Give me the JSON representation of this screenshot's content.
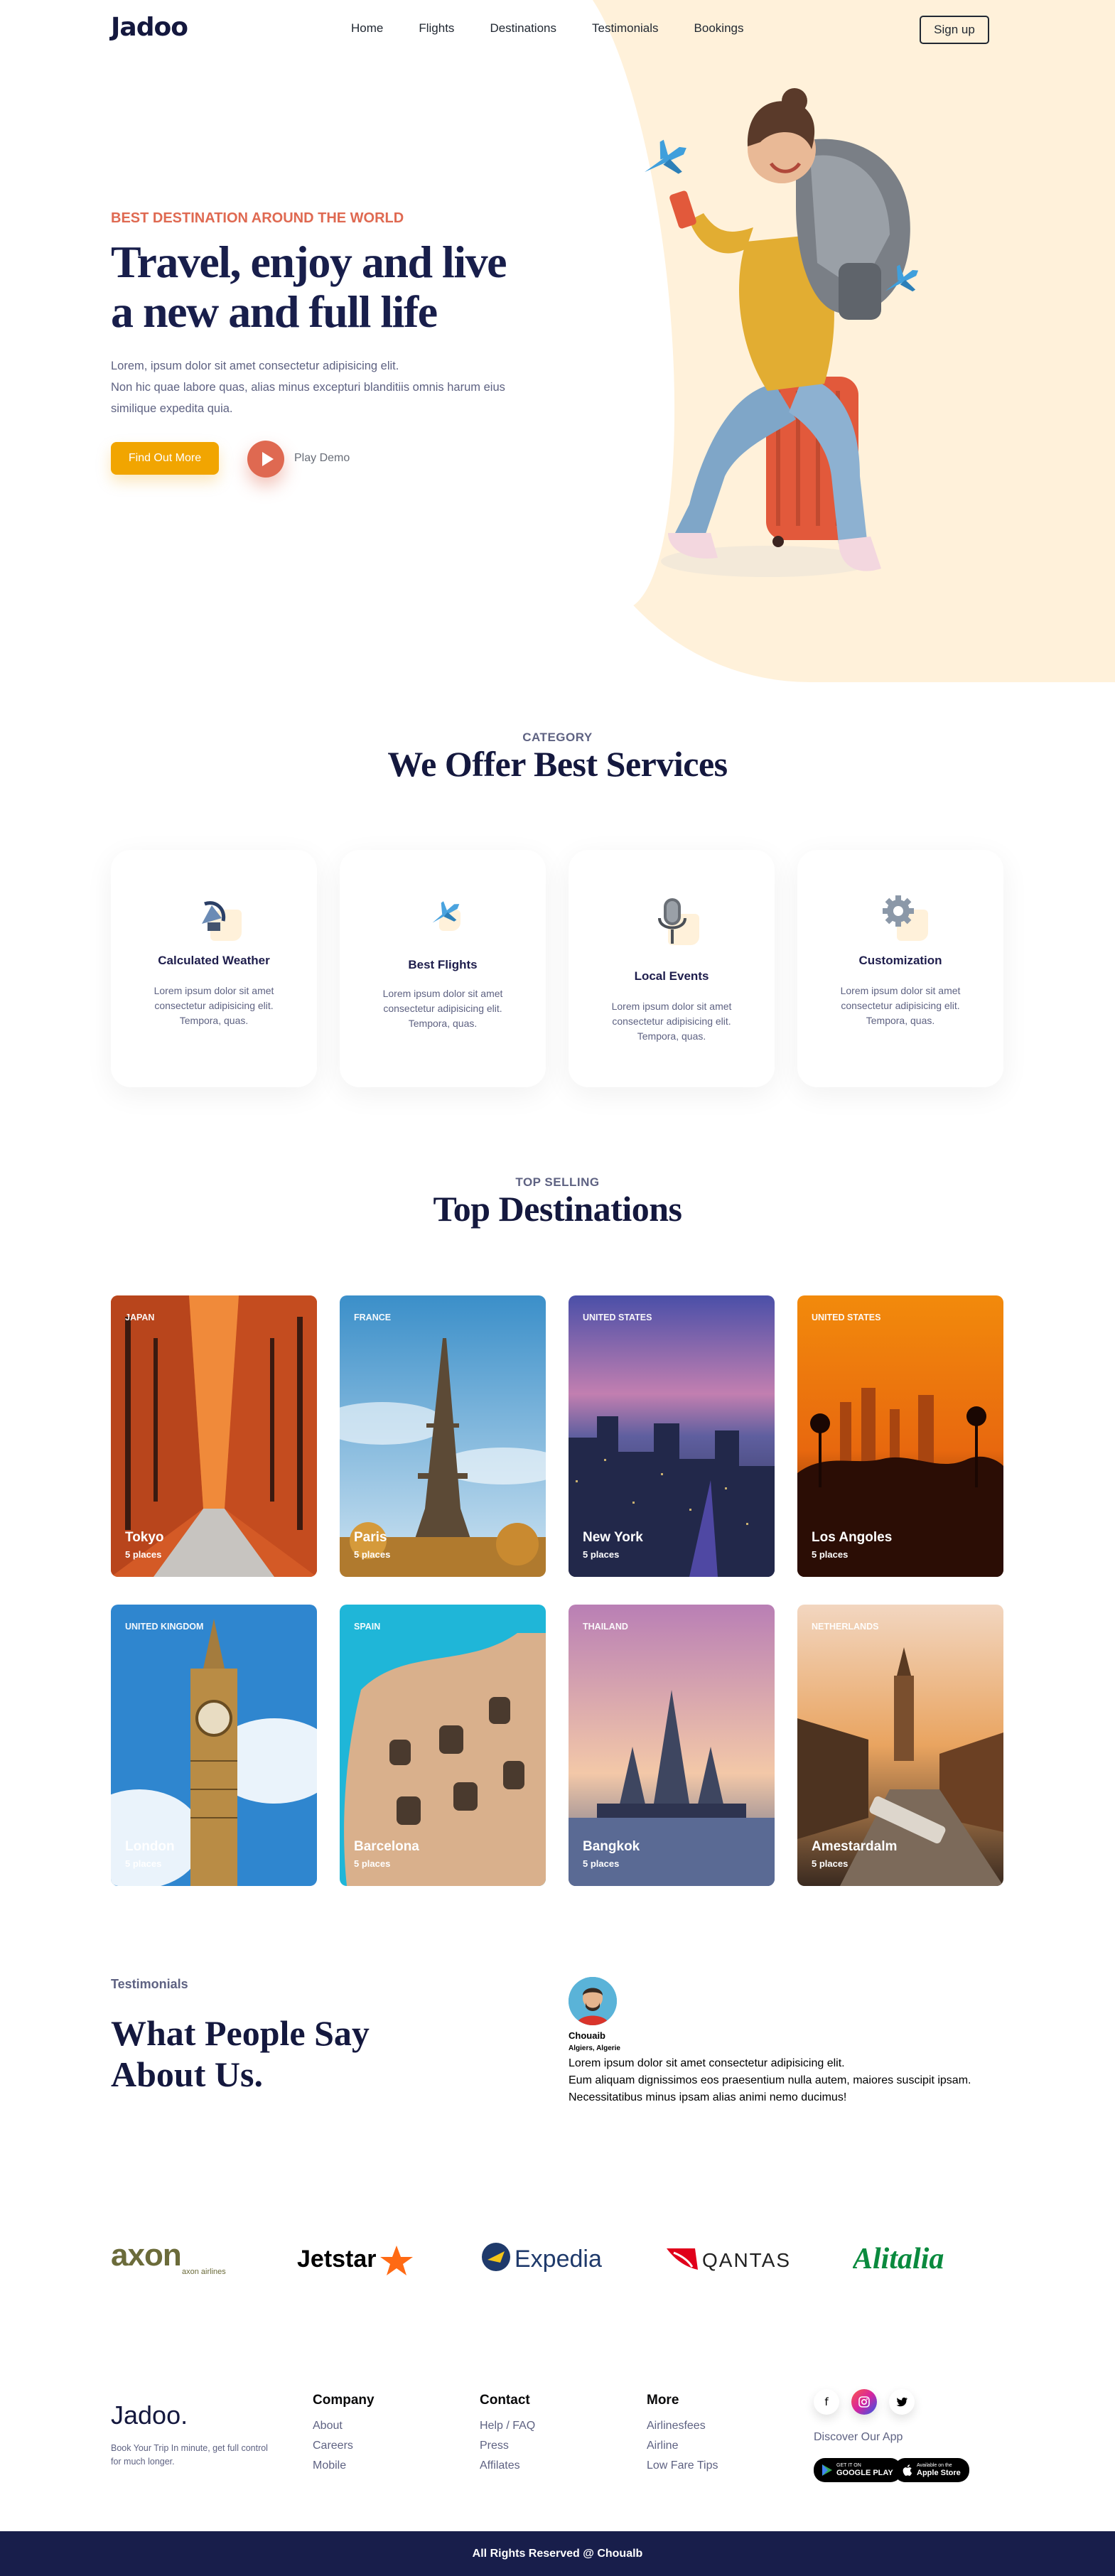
{
  "header": {
    "logo": "Jadoo",
    "nav": [
      "Home",
      "Flights",
      "Destinations",
      "Testimonials",
      "Bookings"
    ],
    "signup_label": "Sign up"
  },
  "hero": {
    "kicker": "BEST DESTINATION AROUND THE WORLD",
    "title_line1": "Travel, enjoy and live",
    "title_line2": "a new and full life",
    "text_line1": "Lorem, ipsum dolor sit amet consectetur adipisicing elit.",
    "text_line2": "Non hic quae labore quas, alias minus excepturi blanditiis omnis harum eius",
    "text_line3": "similique expedita quia.",
    "find_out_label": "Find Out More",
    "play_label": "Play Demo"
  },
  "services": {
    "kicker": "CATEGORY",
    "title": "We Offer Best Services",
    "items": [
      {
        "icon": "satellite-dish-icon",
        "title": "Calculated Weather",
        "text": "Lorem ipsum dolor sit amet consectetur adipisicing elit. Tempora, quas."
      },
      {
        "icon": "airplane-icon",
        "title": "Best Flights",
        "text": "Lorem ipsum dolor sit amet consectetur adipisicing elit. Tempora, quas."
      },
      {
        "icon": "microphone-icon",
        "title": "Local Events",
        "text": "Lorem ipsum dolor sit amet consectetur adipisicing elit. Tempora, quas."
      },
      {
        "icon": "gear-icon",
        "title": "Customization",
        "text": "Lorem ipsum dolor sit amet consectetur adipisicing elit. Tempora, quas."
      }
    ]
  },
  "destinations": {
    "kicker": "TOP SELLING",
    "title": "Top Destinations",
    "items": [
      {
        "country": "JAPAN",
        "city": "Tokyo",
        "places": "5 places"
      },
      {
        "country": "FRANCE",
        "city": "Paris",
        "places": "5 places"
      },
      {
        "country": "UNITED STATES",
        "city": "New York",
        "places": "5 places"
      },
      {
        "country": "UNITED STATES",
        "city": "Los Angoles",
        "places": "5 places"
      },
      {
        "country": "UNITED KINGDOM",
        "city": "London",
        "places": "5 places"
      },
      {
        "country": "SPAIN",
        "city": "Barcelona",
        "places": "5 places"
      },
      {
        "country": "THAILAND",
        "city": "Bangkok",
        "places": "5 places"
      },
      {
        "country": "NETHERLANDS",
        "city": "Amestardalm",
        "places": "5 places"
      }
    ]
  },
  "testimonials": {
    "kicker": "Testimonials",
    "title_line1": "What People Say",
    "title_line2": "About Us.",
    "name": "Chouaib",
    "location": "Algiers, Algerie",
    "quote_line1": "Lorem ipsum dolor sit amet consectetur adipisicing elit.",
    "quote_line2": "Eum aliquam dignissimos eos praesentium nulla autem, maiores suscipit ipsam.",
    "quote_line3": "Necessitatibus minus ipsam alias animi nemo ducimus!"
  },
  "partners": [
    "axon airlines",
    "Jetstar",
    "Expedia",
    "QANTAS",
    "Alitalia"
  ],
  "footer": {
    "logo": "Jadoo.",
    "tagline": "Book Your Trip In minute, get full control for much longer.",
    "columns": [
      {
        "title": "Company",
        "links": [
          "About",
          "Careers",
          "Mobile"
        ]
      },
      {
        "title": "Contact",
        "links": [
          "Help / FAQ",
          "Press",
          "Affilates"
        ]
      },
      {
        "title": "More",
        "links": [
          "Airlinesfees",
          "Airline",
          "Low Fare Tips"
        ]
      }
    ],
    "social": [
      "facebook-icon",
      "instagram-icon",
      "twitter-icon"
    ],
    "discover": "Discover Our App",
    "google_play_small": "GET IT ON",
    "google_play_big": "GOOGLE PLAY",
    "app_store_small": "Available on the",
    "app_store_big": "Apple Store",
    "copyright": "All Rights Reserved @ Choualb"
  },
  "colors": {
    "accent": "#f1a501",
    "orange": "#df6951",
    "navy": "#181e4b",
    "blob": "#fff1da"
  }
}
